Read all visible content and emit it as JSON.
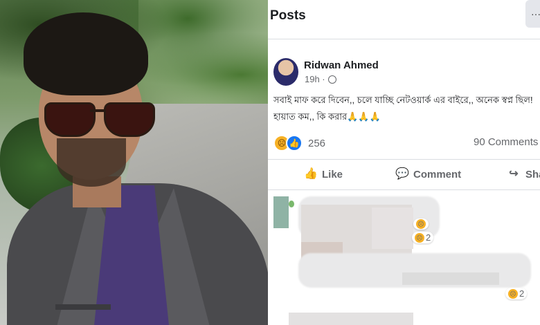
{
  "panel": {
    "title": "Posts",
    "more_label": "···"
  },
  "post": {
    "author": "Ridwan Ahmed",
    "time": "19h ·",
    "text_line1": "সবাই মাফ করে দিবেন,, চলে যাচ্ছি নেটওয়ার্ক এর বাইরে,, অনেক স্বপ্ন ছিল!",
    "text_line2": "হায়াত কম,, কি করার🙏🙏🙏",
    "reaction_count": "256",
    "comments_count": "90 Comments"
  },
  "actions": {
    "like": "Like",
    "comment": "Comment",
    "share": "Share"
  },
  "comment_badges": {
    "first": "2",
    "second": "2"
  },
  "icons": {
    "globe": "globe-icon",
    "like": "thumbs-up-icon",
    "comment": "comment-bubble-icon",
    "share": "share-arrow-icon",
    "sad": "sad-reaction-icon"
  },
  "colors": {
    "facebook_blue": "#1877f2",
    "reaction_sad": "#f7b125",
    "secondary_text": "#65676b"
  }
}
